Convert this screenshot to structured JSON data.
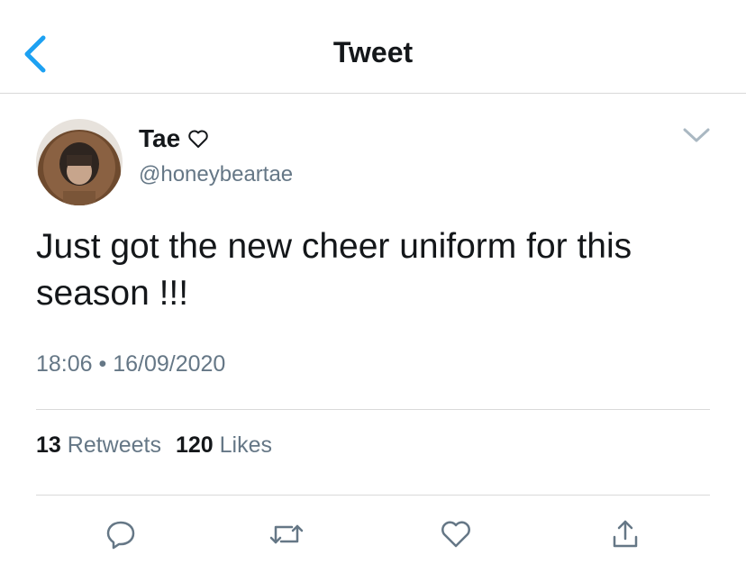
{
  "header": {
    "title": "Tweet",
    "back_icon": "chevron-left-icon",
    "accent": "#1da1f2"
  },
  "author": {
    "name": "Tae",
    "name_icon": "heart-outline-icon",
    "handle": "@honeybeartae"
  },
  "tweet": {
    "text": "Just got the new cheer uniform for this season !!!",
    "time": "18:06",
    "date": "16/09/2020"
  },
  "stats": {
    "retweets_count": "13",
    "retweets_label": "Retweets",
    "likes_count": "120",
    "likes_label": "Likes"
  },
  "actions": [
    "reply-icon",
    "retweet-icon",
    "like-icon",
    "share-icon"
  ],
  "colors": {
    "text": "#14171a",
    "secondary": "#657786",
    "divider": "#d9d9d9",
    "icon": "#657786"
  }
}
